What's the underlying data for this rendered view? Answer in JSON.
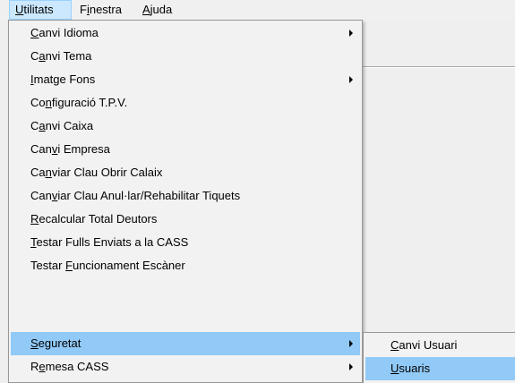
{
  "menubar": {
    "items": [
      {
        "label": "Utilitats",
        "mnemonic_index": 0,
        "active": true
      },
      {
        "label": "Finestra",
        "mnemonic_index": 1,
        "active": false
      },
      {
        "label": "Ajuda",
        "mnemonic_index": 0,
        "active": false
      }
    ]
  },
  "dropdown": {
    "items": [
      {
        "label": "Canvi Idioma",
        "pre": "",
        "mn": "C",
        "post": "anvi Idioma",
        "submenu": true,
        "highlighted": false
      },
      {
        "label": "Canvi Tema",
        "pre": "C",
        "mn": "a",
        "post": "nvi Tema",
        "submenu": false,
        "highlighted": false
      },
      {
        "label": "Imatge Fons",
        "pre": "",
        "mn": "I",
        "post": "matge Fons",
        "submenu": true,
        "highlighted": false
      },
      {
        "label": "Configuració T.P.V.",
        "pre": "Co",
        "mn": "n",
        "post": "figuració T.P.V.",
        "submenu": false,
        "highlighted": false
      },
      {
        "label": "Canvi Caixa",
        "pre": "C",
        "mn": "a",
        "post": "nvi Caixa",
        "submenu": false,
        "highlighted": false
      },
      {
        "label": "Canvi Empresa",
        "pre": "Can",
        "mn": "v",
        "post": "i Empresa",
        "submenu": false,
        "highlighted": false
      },
      {
        "label": "Canviar Clau Obrir Calaix",
        "pre": "Ca",
        "mn": "n",
        "post": "viar Clau Obrir Calaix",
        "submenu": false,
        "highlighted": false
      },
      {
        "label": "Canviar Clau Anul·lar/Rehabilitar Tiquets",
        "pre": "Can",
        "mn": "v",
        "post": "iar Clau Anul·lar/Rehabilitar Tiquets",
        "submenu": false,
        "highlighted": false
      },
      {
        "label": "Recalcular Total Deutors",
        "pre": "",
        "mn": "R",
        "post": "ecalcular Total Deutors",
        "submenu": false,
        "highlighted": false
      },
      {
        "label": "Testar Fulls Enviats a la CASS",
        "pre": "",
        "mn": "T",
        "post": "estar Fulls Enviats a la CASS",
        "submenu": false,
        "highlighted": false
      },
      {
        "label": "Testar Funcionament Escàner",
        "pre": "Testar ",
        "mn": "F",
        "post": "uncionament Escàner",
        "submenu": false,
        "highlighted": false
      },
      {
        "label": "Seguretat",
        "pre": "",
        "mn": "S",
        "post": "eguretat",
        "submenu": true,
        "highlighted": true
      },
      {
        "label": "Remesa CASS",
        "pre": "R",
        "mn": "e",
        "post": "mesa CASS",
        "submenu": true,
        "highlighted": false
      }
    ]
  },
  "submenu": {
    "items": [
      {
        "label": "Canvi Usuari",
        "pre": "",
        "mn": "C",
        "post": "anvi Usuari",
        "highlighted": false
      },
      {
        "label": "Usuaris",
        "pre": "",
        "mn": "U",
        "post": "suaris",
        "highlighted": true
      }
    ]
  },
  "colors": {
    "menu_bg": "#f2f2f2",
    "highlight": "#91c9f7",
    "menubar_active_bg": "#cce8ff",
    "menubar_active_border": "#99d1ff",
    "border": "#979797"
  }
}
